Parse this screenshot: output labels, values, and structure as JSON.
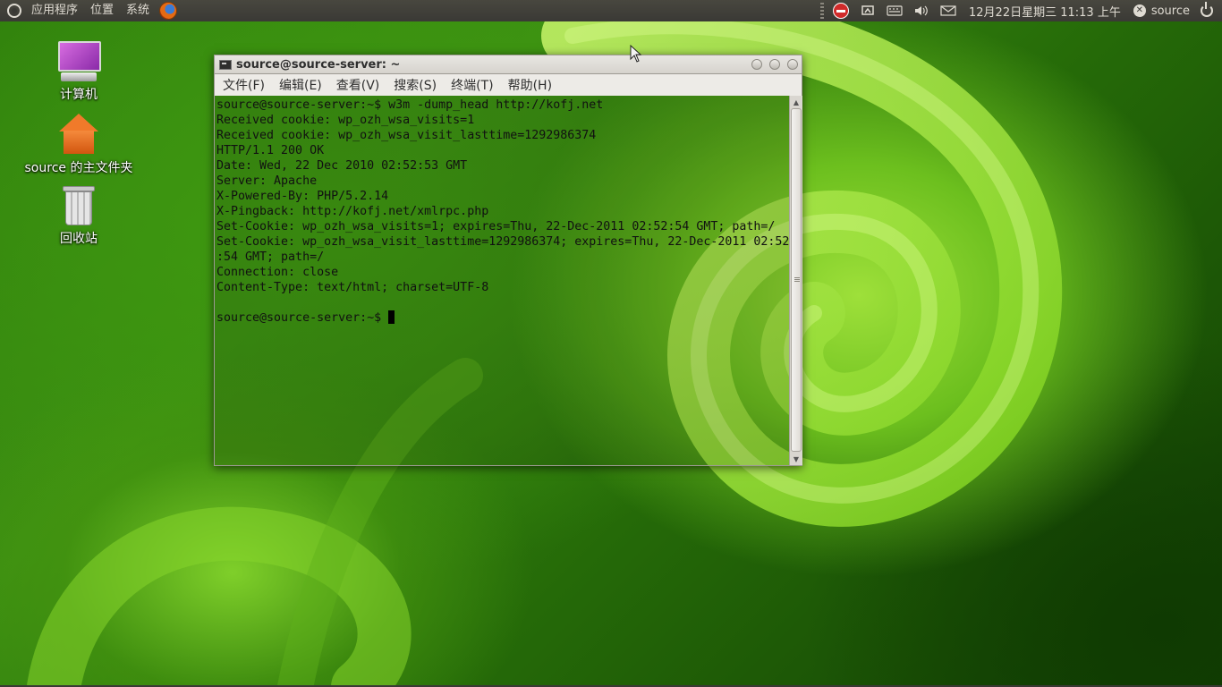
{
  "top_panel": {
    "menus": [
      "应用程序",
      "位置",
      "系统"
    ],
    "clock": "12月22日星期三 11:13 上午",
    "user": "source",
    "tray_icons": [
      "no-entry-icon",
      "network-icon",
      "keyboard-icon",
      "volume-icon",
      "mail-icon"
    ]
  },
  "desktop_icons": [
    {
      "label": "计算机",
      "icon": "computer-icon"
    },
    {
      "label": "source 的主文件夹",
      "icon": "home-folder-icon"
    },
    {
      "label": "回收站",
      "icon": "trash-icon"
    }
  ],
  "terminal": {
    "title": "source@source-server: ~",
    "menus": [
      "文件(F)",
      "编辑(E)",
      "查看(V)",
      "搜索(S)",
      "终端(T)",
      "帮助(H)"
    ],
    "lines": [
      "source@source-server:~$ w3m -dump_head http://kofj.net",
      "Received cookie: wp_ozh_wsa_visits=1",
      "Received cookie: wp_ozh_wsa_visit_lasttime=1292986374",
      "HTTP/1.1 200 OK",
      "Date: Wed, 22 Dec 2010 02:52:53 GMT",
      "Server: Apache",
      "X-Powered-By: PHP/5.2.14",
      "X-Pingback: http://kofj.net/xmlrpc.php",
      "Set-Cookie: wp_ozh_wsa_visits=1; expires=Thu, 22-Dec-2011 02:52:54 GMT; path=/",
      "Set-Cookie: wp_ozh_wsa_visit_lasttime=1292986374; expires=Thu, 22-Dec-2011 02:52",
      ":54 GMT; path=/",
      "Connection: close",
      "Content-Type: text/html; charset=UTF-8",
      ""
    ],
    "prompt": "source@source-server:~$ "
  },
  "colors": {
    "panel_bg": "#3a3935",
    "panel_text": "#dfdbd2",
    "terminal_text": "#111111"
  }
}
